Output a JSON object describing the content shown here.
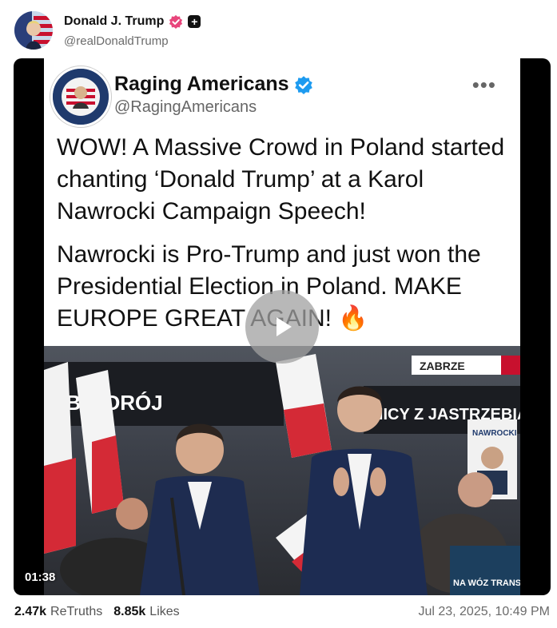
{
  "author": {
    "display_name": "Donald J. Trump",
    "handle": "@realDonaldTrump",
    "avatar_icon": "profile-photo-flag"
  },
  "video": {
    "duration": "01:38",
    "card": {
      "display_name": "Raging Americans",
      "handle": "@RagingAmericans",
      "more_label": "•••",
      "paragraph_1": "WOW! A Massive Crowd in Poland started chanting ‘Donald Trump’ at a Karol Nawrocki Campaign Speech!",
      "paragraph_2": "Nawrocki is Pro-Trump and just won the Presidential Election in Poland. MAKE EUROPE GREAT AGAIN!",
      "emoji": "🔥"
    },
    "photo": {
      "banner_left": "EBI ZDRÓJ",
      "banner_right": "NICY Z JASTRZĘBIA",
      "sign_top": "ZABRZE",
      "poster_text": "NAWROCKI",
      "ticker_text": "NA WÓZ TRANSM"
    }
  },
  "stats": {
    "retruths_count": "2.47k",
    "retruths_label": "ReTruths",
    "likes_count": "8.85k",
    "likes_label": "Likes"
  },
  "timestamp": "Jul 23, 2025, 10:49 PM",
  "colors": {
    "verified_pink": "#e8467c",
    "verified_blue": "#1d9bf0",
    "background": "#ffffff",
    "video_bg": "#000000"
  }
}
